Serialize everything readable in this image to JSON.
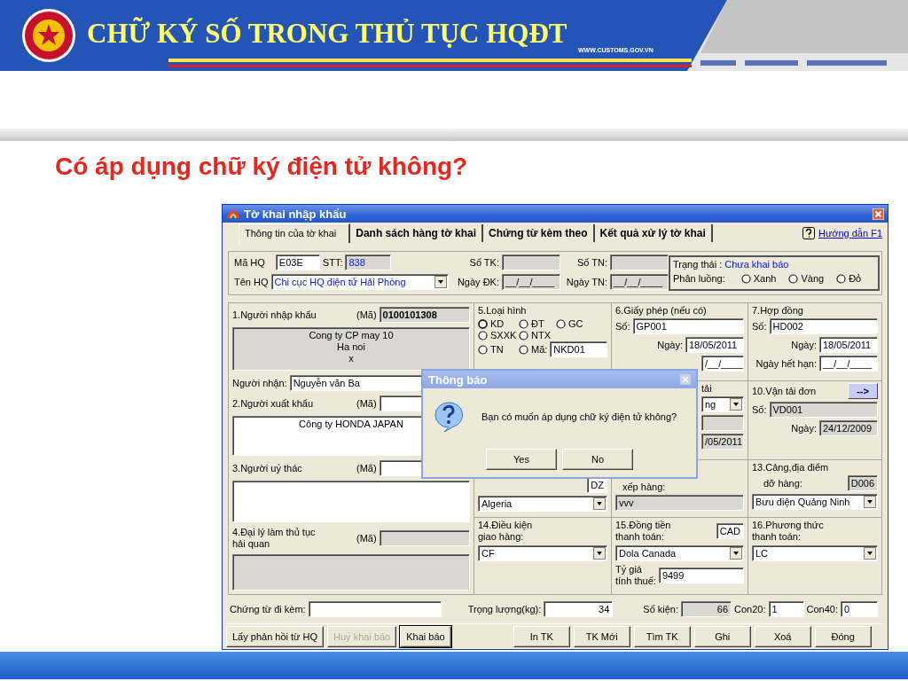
{
  "slide": {
    "title": "CHỮ KÝ SỐ TRONG THỦ TỤC HQĐT",
    "website": "WWW.CUSTOMS.GOV.VN",
    "question": "Có áp dụng chữ ký điện tử không?"
  },
  "window": {
    "title": "Tờ khai nhập khẩu"
  },
  "tabs": [
    {
      "label": "Thông tin của tờ khai",
      "selected": true
    },
    {
      "label": "Danh sách hàng tờ khai",
      "selected": false
    },
    {
      "label": "Chứng từ kèm theo",
      "selected": false
    },
    {
      "label": "Kết quả xử lý tờ khai",
      "selected": false
    }
  ],
  "help_link": "Hướng dẫn F1",
  "header": {
    "fields": [
      {
        "label": "Mã HQ",
        "value": "E03E",
        "readonly": false
      },
      {
        "label": "STT:",
        "value": "838",
        "readonly": true
      },
      {
        "label": "Số TK:",
        "readonly": true
      },
      {
        "label": "Số TN:",
        "readonly": true
      },
      {
        "label": "Tên HQ",
        "kind": "dropdown",
        "value": "Chi cục HQ điện tử Hải Phòng"
      },
      {
        "label": "Ngày ĐK:",
        "value": "__/__/____",
        "readonly": true
      },
      {
        "label": "Ngày TN:",
        "value": "__/__/____",
        "readonly": true
      }
    ],
    "status": {
      "label": "Trạng thái :",
      "value": "Chưa khai báo"
    },
    "routing": {
      "label": "Phân luồng:",
      "options": [
        {
          "label": "Xanh",
          "selected": false
        },
        {
          "label": "Vàng",
          "selected": false
        },
        {
          "label": "Đỏ",
          "selected": false
        }
      ]
    }
  },
  "parties": [
    {
      "title": "1.Người nhập khẩu",
      "code_label": "(Mã)",
      "code": {
        "value": "0100101308",
        "readonly": true
      },
      "details": {
        "lines": [
          "Cong ty CP may 10",
          "Ha noi",
          "x"
        ],
        "readonly": true
      }
    },
    {
      "title": "2.Người xuất khẩu",
      "code_label": "(Mã)",
      "code": {
        "readonly": false
      },
      "details": {
        "lines": [
          "Công ty HONDA JAPAN"
        ],
        "readonly": false
      }
    },
    {
      "title": "3.Người uỷ thác",
      "code_label": "(Mã)",
      "code": {
        "readonly": false
      },
      "details": {
        "readonly": false
      }
    },
    {
      "title": "4.Đại lý làm thủ tục hải quan",
      "code_label": "(Mã)",
      "code": {
        "readonly": true
      },
      "details": {
        "readonly": true
      }
    }
  ],
  "receiver": {
    "label": "Người nhận:",
    "value": "Nguyễn văn Ba",
    "readonly": false
  },
  "import_type": {
    "title": "5.Loại hình",
    "options": [
      {
        "label": "KD",
        "selected": true
      },
      {
        "label": "ĐT",
        "selected": false
      },
      {
        "label": "GC",
        "selected": false
      },
      {
        "label": "SXXK",
        "selected": false
      },
      {
        "label": "NTX",
        "selected": false
      },
      {
        "label": "TN",
        "selected": false
      },
      {
        "label": "Mã:",
        "selected": false
      }
    ],
    "code": {
      "value": "NKD01",
      "readonly": false
    }
  },
  "license": {
    "title": "6.Giấy phép (nếu có)",
    "number": {
      "label": "Số:",
      "value": "GP001",
      "readonly": false
    },
    "date": {
      "label": "Ngày:",
      "value": "18/05/2011",
      "readonly": false
    },
    "expiry": {
      "value": "/__/____",
      "readonly": false
    }
  },
  "contract": {
    "title": "7.Hợp đồng",
    "number": {
      "label": "Số:",
      "value": "HD002",
      "readonly": false
    },
    "date": {
      "label": "Ngày:",
      "value": "18/05/2011",
      "readonly": false
    },
    "expiry": {
      "label": "Ngày hết hạn:",
      "value": "__/__/____",
      "readonly": false
    }
  },
  "transport": {
    "label": "tải",
    "mode": {
      "kind": "dropdown",
      "value": "ng"
    },
    "number": {
      "readonly": true
    },
    "date": {
      "value": "/05/2011",
      "readonly": true
    }
  },
  "bill": {
    "title": "10.Vận tải đơn",
    "button": "-->",
    "number": {
      "label": "Số:",
      "value": "VD001",
      "readonly": true
    },
    "date": {
      "label": "Ngày:",
      "value": "24/12/2009",
      "readonly": true
    }
  },
  "country": {
    "code": {
      "value": "DZ",
      "readonly": false
    },
    "name": {
      "kind": "dropdown",
      "value": "Algeria"
    }
  },
  "loading_port": {
    "label": "xếp hàng:",
    "name": {
      "value": "vvv",
      "readonly": true
    }
  },
  "discharge_port": {
    "title": "13.Cảng,địa điểm",
    "label": "dỡ hàng:",
    "code": {
      "value": "D006",
      "readonly": true
    },
    "name": {
      "kind": "dropdown",
      "value": "Bưu điện Quảng Ninh"
    }
  },
  "delivery": {
    "title": [
      "14.Điều kiện",
      "giao hàng:"
    ],
    "value": {
      "kind": "dropdown",
      "value": "CF"
    }
  },
  "currency": {
    "title": [
      "15.Đồng tiền",
      "thanh toán:"
    ],
    "code": {
      "value": "CAD",
      "readonly": false
    },
    "name": {
      "kind": "dropdown",
      "value": "Dola Canada"
    },
    "rate_label": [
      "Tỷ giá",
      "tính thuế:"
    ],
    "rate": {
      "value": "9499",
      "readonly": false
    }
  },
  "payment": {
    "title": [
      "16.Phương thức",
      "thanh toán:"
    ],
    "value": {
      "kind": "dropdown",
      "value": "LC"
    }
  },
  "footer_fields": [
    {
      "label": "Chứng từ đi kèm:",
      "readonly": false
    },
    {
      "label": "Trọng lượng(kg):",
      "value": "34",
      "readonly": false
    },
    {
      "label": "Số kiện:",
      "value": "66",
      "readonly": true
    },
    {
      "label": "Con20:",
      "value": "1",
      "readonly": false
    },
    {
      "label": "Con40:",
      "value": "0",
      "readonly": false
    }
  ],
  "buttons": [
    {
      "label": "Lấy phản hồi từ HQ",
      "disabled": false,
      "default": false
    },
    {
      "label": "Huỷ khai báo",
      "disabled": true,
      "default": false
    },
    {
      "label": "Khai báo",
      "disabled": false,
      "default": true
    },
    {
      "label": "In TK",
      "disabled": false,
      "default": false
    },
    {
      "label": "TK Mới",
      "disabled": false,
      "default": false
    },
    {
      "label": "Tìm TK",
      "disabled": false,
      "default": false
    },
    {
      "label": "Ghi",
      "disabled": false,
      "default": false
    },
    {
      "label": "Xoá",
      "disabled": false,
      "default": false
    },
    {
      "label": "Đóng",
      "disabled": false,
      "default": false
    }
  ],
  "dialog": {
    "title": "Thông báo",
    "message": "Bạn có muốn áp dụng chữ ký điện tử không?",
    "buttons": [
      "Yes",
      "No"
    ]
  }
}
